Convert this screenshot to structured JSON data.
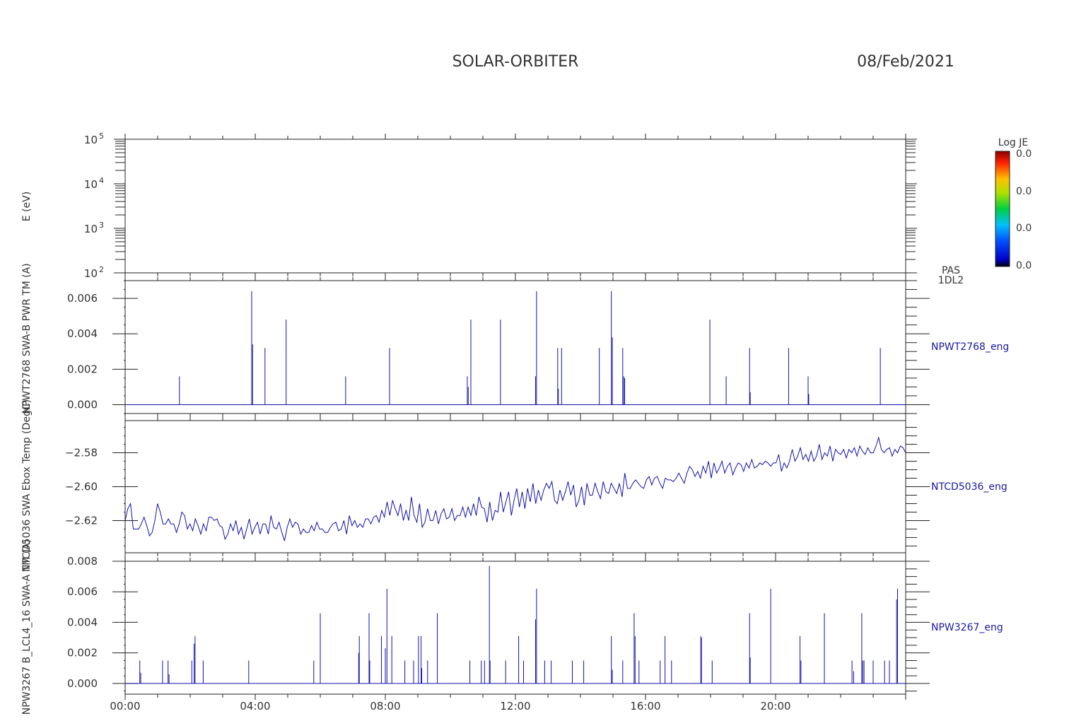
{
  "header": {
    "mission": "SOLAR-ORBITER",
    "date": "08/Feb/2021"
  },
  "x_axis": {
    "range_hours": [
      0,
      24
    ],
    "ticks": [
      {
        "h": 0,
        "label": "00:00"
      },
      {
        "h": 4,
        "label": "04:00"
      },
      {
        "h": 8,
        "label": "08:00"
      },
      {
        "h": 12,
        "label": "12:00"
      },
      {
        "h": 16,
        "label": "16:00"
      },
      {
        "h": 20,
        "label": "20:00"
      }
    ]
  },
  "colorbar": {
    "title": "Log JE",
    "labels": [
      "0.0",
      "0.0",
      "0.0",
      "0.0"
    ]
  },
  "chart_data": [
    {
      "type": "heatmap",
      "ylabel": "E (eV)",
      "yscale": "log",
      "ylim": [
        100,
        100000
      ],
      "ytick_labels": [
        {
          "base": "10",
          "exp": "2",
          "v": 100
        },
        {
          "base": "10",
          "exp": "3",
          "v": 1000
        },
        {
          "base": "10",
          "exp": "4",
          "v": 10000
        },
        {
          "base": "10",
          "exp": "5",
          "v": 100000
        }
      ],
      "side_label": [
        "PAS",
        "1DL2"
      ],
      "values": []
    },
    {
      "type": "line",
      "ylabel": "NPWT2768 SWA-B PWR TM (A)",
      "ylim": [
        -0.0005,
        0.007
      ],
      "ytick_labels": [
        {
          "v": 0.0,
          "label": "0.000"
        },
        {
          "v": 0.002,
          "label": "0.002"
        },
        {
          "v": 0.004,
          "label": "0.004"
        },
        {
          "v": 0.006,
          "label": "0.006"
        }
      ],
      "side_label": "NPWT2768_eng",
      "series": [
        {
          "baseline": 0,
          "spikes": [
            [
              1.67,
              0.0016
            ],
            [
              3.89,
              0.0064
            ],
            [
              3.92,
              0.0034
            ],
            [
              4.3,
              0.0032
            ],
            [
              4.95,
              0.0048
            ],
            [
              6.78,
              0.0016
            ],
            [
              8.13,
              0.0032
            ],
            [
              10.52,
              0.0016
            ],
            [
              10.55,
              0.001
            ],
            [
              10.63,
              0.0048
            ],
            [
              11.54,
              0.0048
            ],
            [
              12.62,
              0.0016
            ],
            [
              12.65,
              0.0064
            ],
            [
              13.3,
              0.0032
            ],
            [
              13.32,
              0.0009
            ],
            [
              13.42,
              0.0032
            ],
            [
              14.58,
              0.0032
            ],
            [
              14.95,
              0.0064
            ],
            [
              14.98,
              0.0038
            ],
            [
              15.3,
              0.0032
            ],
            [
              15.33,
              0.0016
            ],
            [
              15.36,
              0.0015
            ],
            [
              17.98,
              0.0048
            ],
            [
              18.48,
              0.0016
            ],
            [
              19.2,
              0.0032
            ],
            [
              19.22,
              0.0007
            ],
            [
              20.4,
              0.0032
            ],
            [
              21.0,
              0.0016
            ],
            [
              21.02,
              0.0006
            ],
            [
              23.22,
              0.0032
            ]
          ]
        }
      ]
    },
    {
      "type": "line",
      "ylabel": "NTCD5036 SWA Ebox Temp (DegC)",
      "ylim": [
        -2.639,
        -2.561
      ],
      "ytick_labels": [
        {
          "v": -2.62,
          "label": "−2.62"
        },
        {
          "v": -2.6,
          "label": "−2.60"
        },
        {
          "v": -2.58,
          "label": "−2.58"
        }
      ],
      "side_label": "NTCD5036_eng",
      "series": [
        {
          "y": [
            -2.62,
            -2.613,
            -2.61,
            -2.625,
            -2.625,
            -2.625,
            -2.622,
            -2.618,
            -2.623,
            -2.629,
            -2.627,
            -2.62,
            -2.61,
            -2.615,
            -2.622,
            -2.622,
            -2.619,
            -2.622,
            -2.622,
            -2.627,
            -2.622,
            -2.615,
            -2.617,
            -2.625,
            -2.622,
            -2.626,
            -2.619,
            -2.623,
            -2.628,
            -2.622,
            -2.626,
            -2.618,
            -2.618,
            -2.62,
            -2.619,
            -2.623,
            -2.624,
            -2.631,
            -2.628,
            -2.622,
            -2.626,
            -2.62,
            -2.628,
            -2.624,
            -2.631,
            -2.625,
            -2.619,
            -2.628,
            -2.624,
            -2.621,
            -2.628,
            -2.622,
            -2.622,
            -2.628,
            -2.617,
            -2.624,
            -2.625,
            -2.621,
            -2.627,
            -2.632,
            -2.624,
            -2.619,
            -2.624,
            -2.621,
            -2.622,
            -2.628,
            -2.625,
            -2.627,
            -2.627,
            -2.623,
            -2.626,
            -2.621,
            -2.625,
            -2.625,
            -2.627,
            -2.627,
            -2.624,
            -2.622,
            -2.621,
            -2.626,
            -2.625,
            -2.62,
            -2.628,
            -2.617,
            -2.623,
            -2.62,
            -2.624,
            -2.622,
            -2.624,
            -2.619,
            -2.619,
            -2.622,
            -2.618,
            -2.617,
            -2.621,
            -2.614,
            -2.618,
            -2.609,
            -2.617,
            -2.608,
            -2.613,
            -2.617,
            -2.61,
            -2.62,
            -2.614,
            -2.62,
            -2.606,
            -2.617,
            -2.621,
            -2.61,
            -2.624,
            -2.621,
            -2.613,
            -2.62,
            -2.62,
            -2.614,
            -2.622,
            -2.616,
            -2.613,
            -2.619,
            -2.618,
            -2.613,
            -2.62,
            -2.617,
            -2.617,
            -2.612,
            -2.618,
            -2.612,
            -2.617,
            -2.61,
            -2.617,
            -2.606,
            -2.612,
            -2.613,
            -2.621,
            -2.609,
            -2.62,
            -2.614,
            -2.615,
            -2.603,
            -2.615,
            -2.609,
            -2.603,
            -2.617,
            -2.608,
            -2.601,
            -2.612,
            -2.603,
            -2.613,
            -2.601,
            -2.609,
            -2.598,
            -2.61,
            -2.602,
            -2.608,
            -2.602,
            -2.598,
            -2.601,
            -2.597,
            -2.608,
            -2.61,
            -2.602,
            -2.608,
            -2.603,
            -2.597,
            -2.605,
            -2.599,
            -2.612,
            -2.608,
            -2.6,
            -2.611,
            -2.598,
            -2.605,
            -2.605,
            -2.598,
            -2.603,
            -2.607,
            -2.597,
            -2.603,
            -2.604,
            -2.598,
            -2.601,
            -2.604,
            -2.598,
            -2.606,
            -2.592,
            -2.601,
            -2.601,
            -2.598,
            -2.596,
            -2.598,
            -2.6,
            -2.601,
            -2.596,
            -2.594,
            -2.599,
            -2.595,
            -2.594,
            -2.598,
            -2.601,
            -2.595,
            -2.596,
            -2.596,
            -2.597,
            -2.595,
            -2.592,
            -2.595,
            -2.598,
            -2.592,
            -2.588,
            -2.59,
            -2.594,
            -2.591,
            -2.595,
            -2.588,
            -2.592,
            -2.585,
            -2.595,
            -2.586,
            -2.592,
            -2.589,
            -2.585,
            -2.592,
            -2.588,
            -2.586,
            -2.593,
            -2.589,
            -2.586,
            -2.587,
            -2.591,
            -2.586,
            -2.589,
            -2.584,
            -2.589,
            -2.588,
            -2.586,
            -2.587,
            -2.585,
            -2.586,
            -2.588,
            -2.586,
            -2.586,
            -2.581,
            -2.591,
            -2.586,
            -2.589,
            -2.585,
            -2.578,
            -2.585,
            -2.582,
            -2.577,
            -2.584,
            -2.581,
            -2.585,
            -2.579,
            -2.585,
            -2.582,
            -2.575,
            -2.584,
            -2.58,
            -2.582,
            -2.576,
            -2.585,
            -2.578,
            -2.58,
            -2.581,
            -2.578,
            -2.583,
            -2.578,
            -2.58,
            -2.577,
            -2.582,
            -2.576,
            -2.579,
            -2.581,
            -2.577,
            -2.58,
            -2.58,
            -2.576,
            -2.571,
            -2.578,
            -2.58,
            -2.578,
            -2.577,
            -2.582,
            -2.578,
            -2.58,
            -2.576,
            -2.577,
            -2.58
          ]
        }
      ]
    },
    {
      "type": "line",
      "ylabel": "NPW3267 B_LCL4_16 SWA-A TM (A)",
      "ylim": [
        -0.0007,
        0.008
      ],
      "ytick_labels": [
        {
          "v": 0.0,
          "label": "0.000"
        },
        {
          "v": 0.002,
          "label": "0.002"
        },
        {
          "v": 0.004,
          "label": "0.004"
        },
        {
          "v": 0.006,
          "label": "0.006"
        },
        {
          "v": 0.008,
          "label": "0.008"
        }
      ],
      "side_label": "NPW3267_eng",
      "series": [
        {
          "baseline": 0,
          "spikes": [
            [
              0.45,
              0.0015
            ],
            [
              0.48,
              0.0007
            ],
            [
              1.15,
              0.0015
            ],
            [
              1.32,
              0.0015
            ],
            [
              1.35,
              0.0006
            ],
            [
              2.05,
              0.0015
            ],
            [
              2.15,
              0.0031
            ],
            [
              2.12,
              0.0026
            ],
            [
              2.4,
              0.0015
            ],
            [
              3.8,
              0.0015
            ],
            [
              5.8,
              0.0015
            ],
            [
              6.0,
              0.0046
            ],
            [
              7.2,
              0.0031
            ],
            [
              7.18,
              0.002
            ],
            [
              7.5,
              0.0046
            ],
            [
              7.52,
              0.0015
            ],
            [
              7.88,
              0.0031
            ],
            [
              8.0,
              0.0023
            ],
            [
              8.05,
              0.0062
            ],
            [
              8.2,
              0.0031
            ],
            [
              8.6,
              0.0015
            ],
            [
              8.87,
              0.0015
            ],
            [
              9.02,
              0.0031
            ],
            [
              9.1,
              0.0031
            ],
            [
              9.12,
              0.001
            ],
            [
              9.3,
              0.0015
            ],
            [
              9.6,
              0.0046
            ],
            [
              10.6,
              0.0015
            ],
            [
              10.95,
              0.0015
            ],
            [
              11.05,
              0.0015
            ],
            [
              11.2,
              0.0077
            ],
            [
              11.22,
              0.0015
            ],
            [
              11.7,
              0.0015
            ],
            [
              12.1,
              0.0031
            ],
            [
              12.25,
              0.0015
            ],
            [
              12.65,
              0.0062
            ],
            [
              12.62,
              0.0042
            ],
            [
              12.9,
              0.0015
            ],
            [
              13.1,
              0.0015
            ],
            [
              13.75,
              0.0015
            ],
            [
              14.1,
              0.0015
            ],
            [
              14.95,
              0.0031
            ],
            [
              14.98,
              0.0009
            ],
            [
              15.3,
              0.0015
            ],
            [
              15.65,
              0.0046
            ],
            [
              15.68,
              0.0031
            ],
            [
              15.8,
              0.0015
            ],
            [
              16.45,
              0.0015
            ],
            [
              16.6,
              0.0031
            ],
            [
              16.8,
              0.0015
            ],
            [
              17.7,
              0.0031
            ],
            [
              17.72,
              0.003
            ],
            [
              18.05,
              0.0015
            ],
            [
              19.2,
              0.0046
            ],
            [
              19.22,
              0.0017
            ],
            [
              19.85,
              0.0062
            ],
            [
              20.75,
              0.0031
            ],
            [
              20.78,
              0.0015
            ],
            [
              21.5,
              0.0046
            ],
            [
              22.35,
              0.0015
            ],
            [
              22.4,
              0.0008
            ],
            [
              22.65,
              0.0046
            ],
            [
              22.68,
              0.0015
            ],
            [
              22.72,
              0.0015
            ],
            [
              23.0,
              0.0015
            ],
            [
              23.35,
              0.0015
            ],
            [
              23.5,
              0.0015
            ],
            [
              23.75,
              0.0062
            ],
            [
              23.72,
              0.0055
            ]
          ]
        }
      ]
    }
  ]
}
